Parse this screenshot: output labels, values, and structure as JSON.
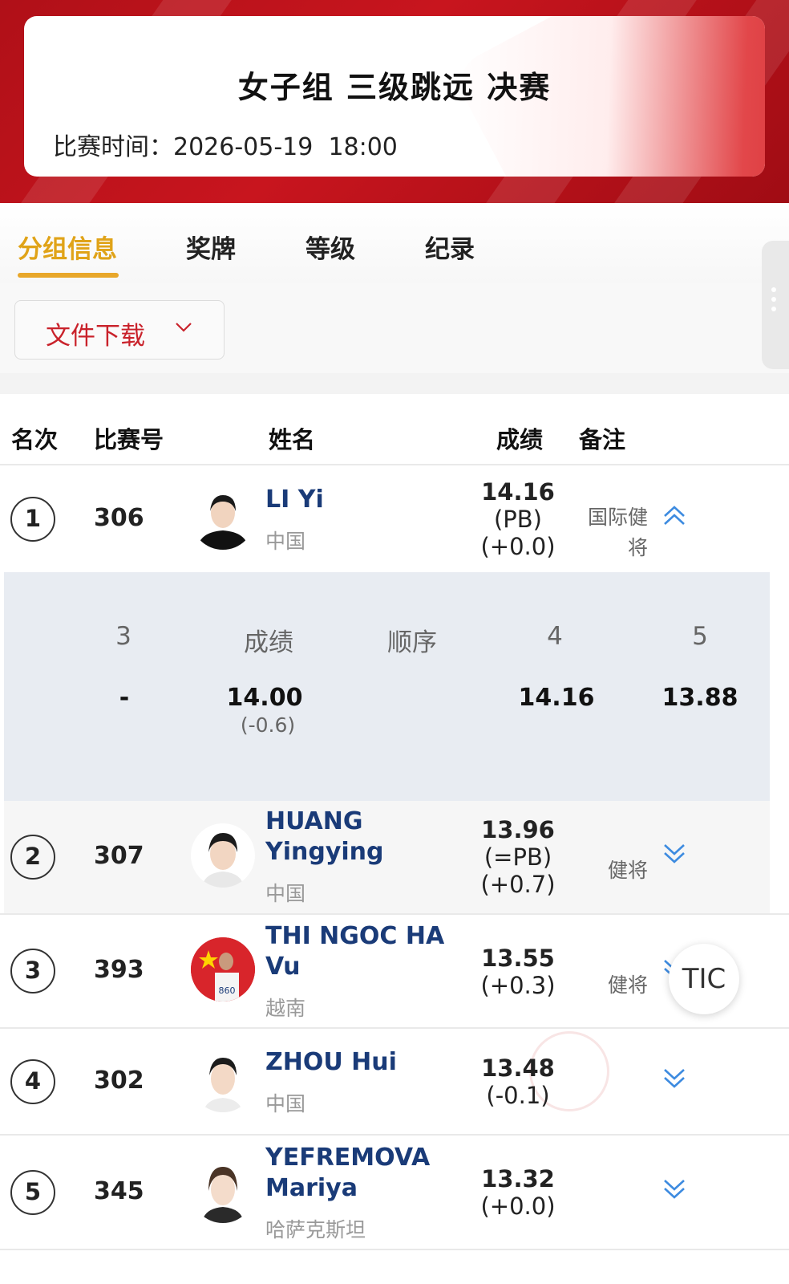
{
  "header": {
    "title": "女子组 三级跳远 决赛",
    "time_label": "比赛时间：",
    "date": "2026-05-19",
    "time": "18:00"
  },
  "tabs": [
    {
      "label": "分组信息",
      "active": true
    },
    {
      "label": "奖牌",
      "active": false
    },
    {
      "label": "等级",
      "active": false
    },
    {
      "label": "纪录",
      "active": false
    }
  ],
  "download": {
    "label": "文件下载"
  },
  "table_headers": {
    "rank": "名次",
    "bib": "比赛号",
    "name": "姓名",
    "result": "成绩",
    "note": "备注"
  },
  "athletes": [
    {
      "rank": "1",
      "bib": "306",
      "name_line1": "LI Yi",
      "name_line2": "",
      "country": "中国",
      "mark": "14.16",
      "pb": "(PB)",
      "wind": "(+0.0)",
      "note_line1": "国际健",
      "note_line2": "将",
      "expanded": true
    },
    {
      "rank": "2",
      "bib": "307",
      "name_line1": "HUANG",
      "name_line2": "Yingying",
      "country": "中国",
      "mark": "13.96",
      "pb": "(=PB)",
      "wind": "(+0.7)",
      "note_line1": "健将",
      "note_line2": "",
      "expanded": false
    },
    {
      "rank": "3",
      "bib": "393",
      "name_line1": "THI NGOC HA",
      "name_line2": "Vu",
      "country": "越南",
      "mark": "13.55",
      "pb": "",
      "wind": "(+0.3)",
      "note_line1": "健将",
      "note_line2": "",
      "expanded": false
    },
    {
      "rank": "4",
      "bib": "302",
      "name_line1": "ZHOU Hui",
      "name_line2": "",
      "country": "中国",
      "mark": "13.48",
      "pb": "",
      "wind": "(-0.1)",
      "note_line1": "",
      "note_line2": "",
      "expanded": false
    },
    {
      "rank": "5",
      "bib": "345",
      "name_line1": "YEFREMOVA",
      "name_line2": "Mariya",
      "country": "哈萨克斯坦",
      "mark": "13.32",
      "pb": "",
      "wind": "(+0.0)",
      "note_line1": "",
      "note_line2": "",
      "expanded": false
    }
  ],
  "expanded_detail": {
    "headers": [
      "3",
      "成绩",
      "顺序",
      "4",
      "5"
    ],
    "values": [
      "-",
      "14.00",
      "",
      "14.16",
      "13.88"
    ],
    "winds": [
      "",
      "(-0.6)",
      "",
      "",
      ""
    ]
  },
  "floating_button": {
    "label": "TIC"
  },
  "colors": {
    "brand_red": "#c8151e",
    "tab_active": "#e0a318",
    "name_blue": "#1a3b78",
    "arrow_blue": "#3d8be0"
  }
}
